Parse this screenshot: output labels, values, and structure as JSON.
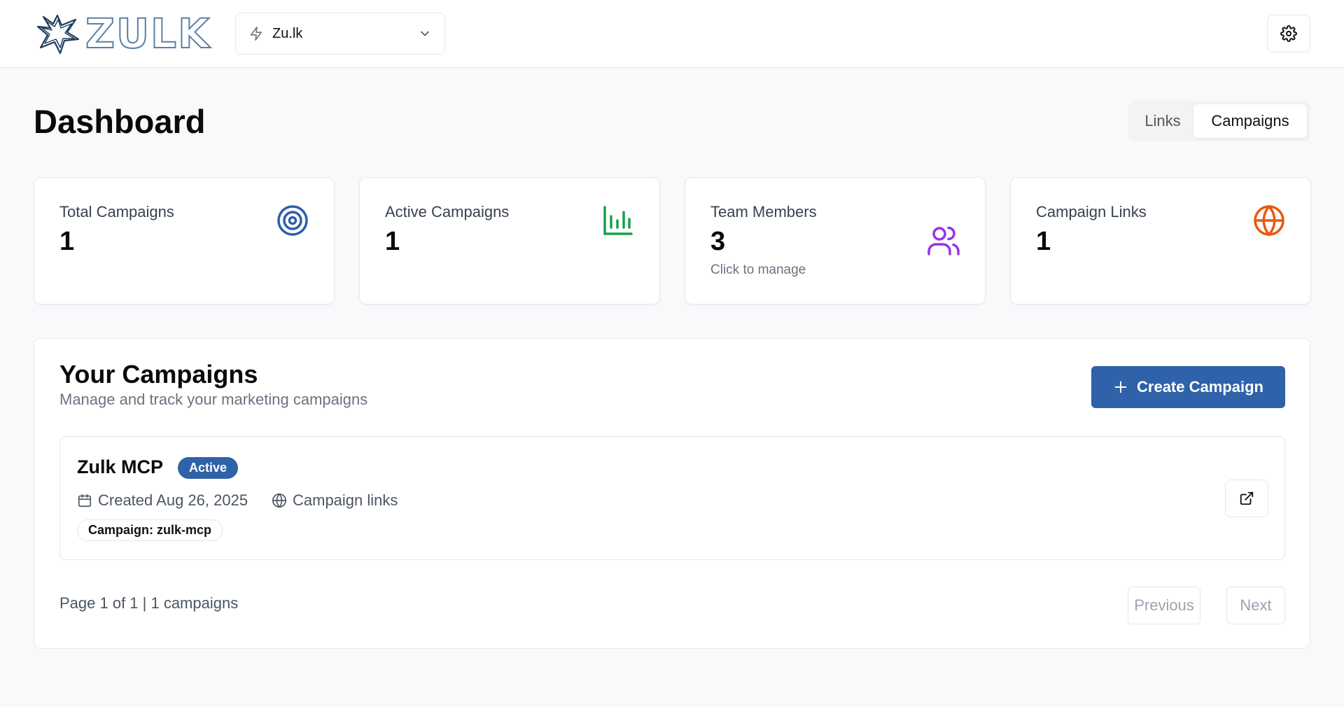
{
  "header": {
    "logo_text": "ZULK",
    "org_selector": {
      "value": "Zu.lk"
    },
    "settings_icon": "gear-icon"
  },
  "page": {
    "title": "Dashboard"
  },
  "view_tabs": [
    {
      "label": "Links",
      "active": false
    },
    {
      "label": "Campaigns",
      "active": true
    }
  ],
  "stats": [
    {
      "label": "Total Campaigns",
      "value": "1",
      "sub": "",
      "icon": "target-icon",
      "color": "#2f5ea8"
    },
    {
      "label": "Active Campaigns",
      "value": "1",
      "sub": "",
      "icon": "bar-chart-icon",
      "color": "#16a34a"
    },
    {
      "label": "Team Members",
      "value": "3",
      "sub": "Click to manage",
      "icon": "users-icon",
      "color": "#9333ea"
    },
    {
      "label": "Campaign Links",
      "value": "1",
      "sub": "",
      "icon": "globe-icon",
      "color": "#ea580c"
    }
  ],
  "campaigns": {
    "title": "Your Campaigns",
    "subtitle": "Manage and track your marketing campaigns",
    "create_label": "Create Campaign",
    "items": [
      {
        "name": "Zulk MCP",
        "status": "Active",
        "created": "Created Aug 26, 2025",
        "links_label": "Campaign links",
        "tag": "Campaign: zulk-mcp"
      }
    ],
    "pagination": {
      "info": "Page 1 of 1 | 1 campaigns",
      "previous_label": "Previous",
      "next_label": "Next"
    }
  },
  "colors": {
    "accent": "#2f62a8",
    "logo": "#5b7fa6"
  }
}
